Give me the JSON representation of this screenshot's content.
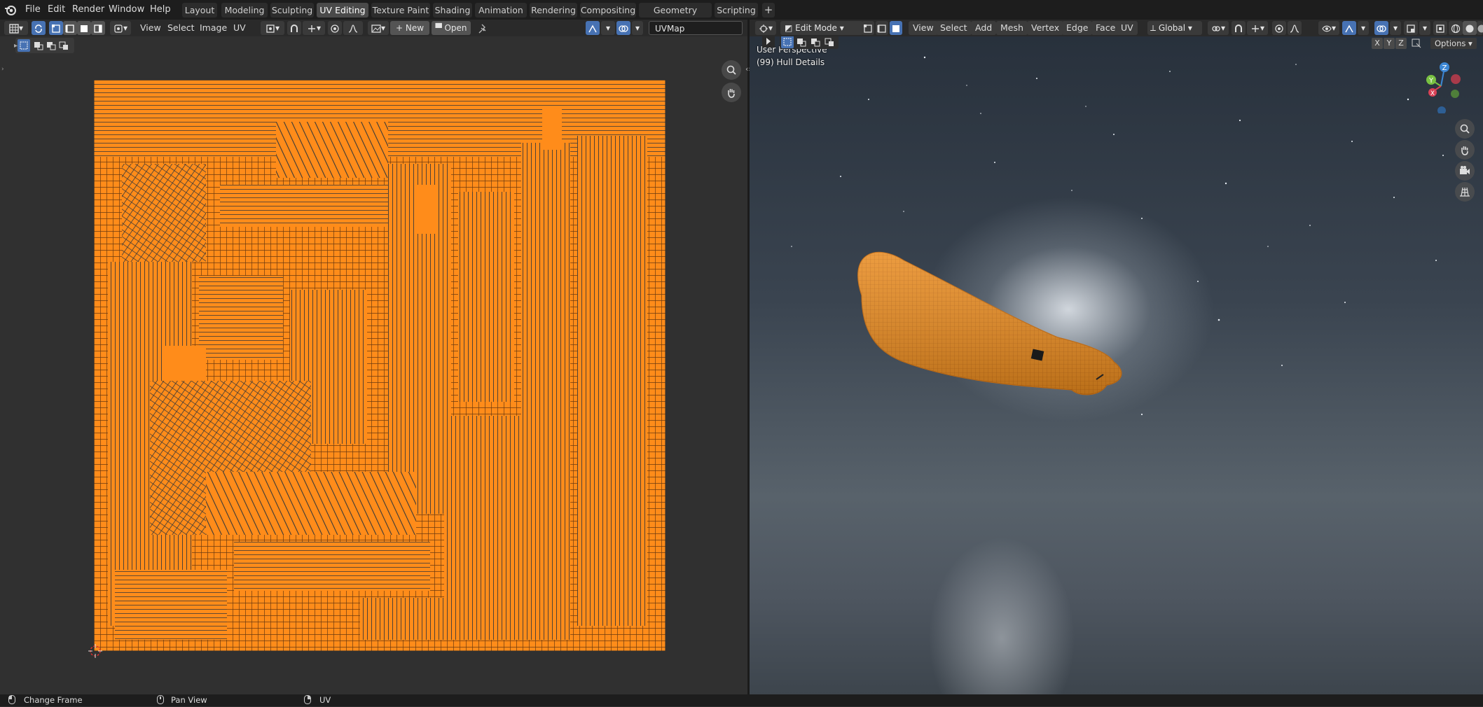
{
  "topbar": {
    "menus": [
      "File",
      "Edit",
      "Render",
      "Window",
      "Help"
    ],
    "workspaces": [
      "Layout",
      "Modeling",
      "Sculpting",
      "UV Editing",
      "Texture Paint",
      "Shading",
      "Animation",
      "Rendering",
      "Compositing",
      "Geometry Nodes",
      "Scripting"
    ],
    "active_workspace": "UV Editing",
    "add_tab": "+"
  },
  "uv_header": {
    "menus": [
      "View",
      "Select",
      "Image",
      "UV"
    ],
    "new_label": "New",
    "open_label": "Open",
    "uvmap_name": "UVMap"
  },
  "viewport_header": {
    "mode": "Edit Mode",
    "menus": [
      "View",
      "Select",
      "Add",
      "Mesh",
      "Vertex",
      "Edge",
      "Face",
      "UV"
    ],
    "orientation": "Global",
    "axes": [
      "X",
      "Y",
      "Z"
    ],
    "options_label": "Options"
  },
  "viewport": {
    "perspective_label": "User Perspective",
    "object_label": "(99) Hull Details"
  },
  "gizmo": {
    "z": "Z",
    "y": "Y",
    "x": "X"
  },
  "statusbar": {
    "items": [
      "Change Frame",
      "Pan View",
      "UV"
    ]
  },
  "colors": {
    "uv_orange": "#ff8c1a",
    "active_blue": "#4772b3",
    "hull_orange": "#e88a1e"
  }
}
